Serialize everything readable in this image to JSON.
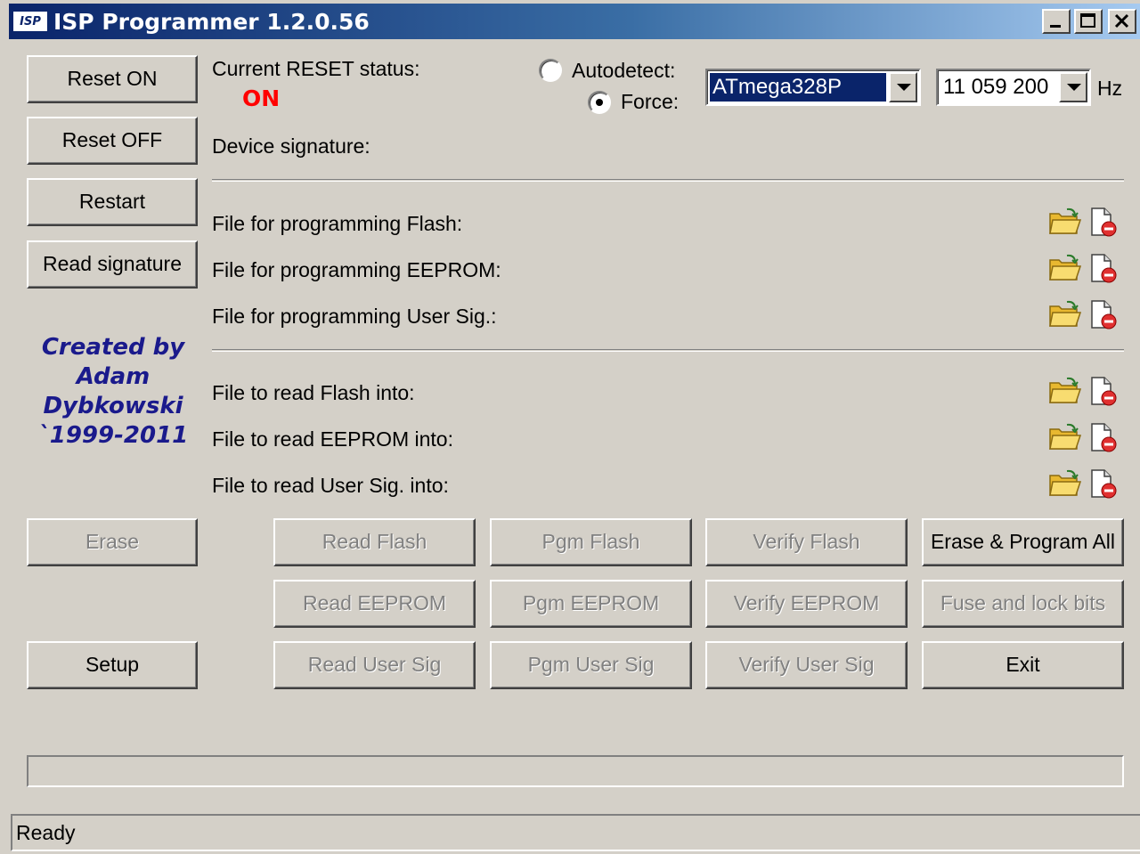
{
  "window": {
    "title": "ISP Programmer 1.2.0.56",
    "logo_text": "ISP",
    "controls": {
      "minimize": "_",
      "maximize": "□",
      "close": "✕"
    }
  },
  "left_buttons": {
    "reset_on": "Reset ON",
    "reset_off": "Reset OFF",
    "restart": "Restart",
    "read_signature": "Read signature"
  },
  "status": {
    "reset_label": "Current RESET status:",
    "reset_value": "ON",
    "reset_value_color": "#ff0000",
    "signature_label": "Device signature:"
  },
  "device": {
    "autodetect_label": "Autodetect:",
    "force_label": "Force:",
    "selected_mode": "Force",
    "chip": "ATmega328P",
    "frequency": "11 059 200",
    "frequency_unit": "Hz"
  },
  "program_files": [
    {
      "label": "File for programming Flash:"
    },
    {
      "label": "File for programming EEPROM:"
    },
    {
      "label": "File for programming User Sig.:"
    }
  ],
  "read_files": [
    {
      "label": "File to read Flash into:"
    },
    {
      "label": "File to read EEPROM into:"
    },
    {
      "label": "File to read User Sig. into:"
    }
  ],
  "credit": {
    "line1": "Created by",
    "line2": "Adam",
    "line3": "Dybkowski",
    "line4": "`1999-2011",
    "color": "#1a1a8c"
  },
  "actions": {
    "erase": "Erase",
    "setup": "Setup",
    "read_flash": "Read Flash",
    "pgm_flash": "Pgm Flash",
    "verify_flash": "Verify Flash",
    "erase_program_all": "Erase & Program All",
    "read_eeprom": "Read EEPROM",
    "pgm_eeprom": "Pgm EEPROM",
    "verify_eeprom": "Verify EEPROM",
    "fuse_lock": "Fuse and lock bits",
    "read_user_sig": "Read User Sig",
    "pgm_user_sig": "Pgm User Sig",
    "verify_user_sig": "Verify User Sig",
    "exit": "Exit"
  },
  "progress": {
    "value": 0
  },
  "statusbar": {
    "text": "Ready"
  },
  "icons": {
    "open": "open-folder-icon",
    "clear": "clear-file-icon"
  },
  "colors": {
    "face": "#d4d0c8",
    "title_start": "#0a246a",
    "title_end": "#a6caf0",
    "selection": "#0a246a"
  }
}
